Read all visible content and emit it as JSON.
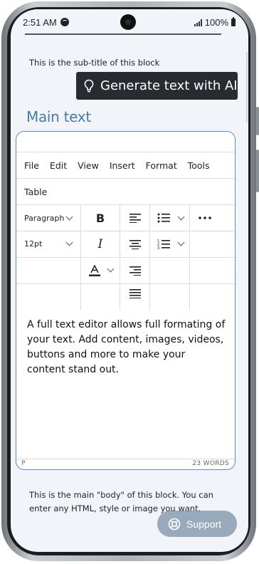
{
  "status_bar": {
    "time": "2:51 AM",
    "battery": "100%"
  },
  "block": {
    "subtitle": "This is the sub-title of this block",
    "generate_button": "Generate text with AI",
    "main_title": "Main text",
    "body_note": "This is the main \"body\" of this block. You can enter any HTML, style or image you want."
  },
  "editor": {
    "menu": [
      "File",
      "Edit",
      "View",
      "Insert",
      "Format",
      "Tools"
    ],
    "menu_row2": "Table",
    "block_format": "Paragraph",
    "font_size": "12pt",
    "content": "A full text editor allows full formating of your text. Add content, images, videos, buttons and more to make your content stand out.",
    "footer_path": "P",
    "word_count": "23 WORDS"
  },
  "support_button": "Support",
  "colors": {
    "accent": "#4a7aa8",
    "editor_border": "#5f8cbc",
    "dark_button": "#282b2f",
    "support_bg": "#788ea6"
  }
}
